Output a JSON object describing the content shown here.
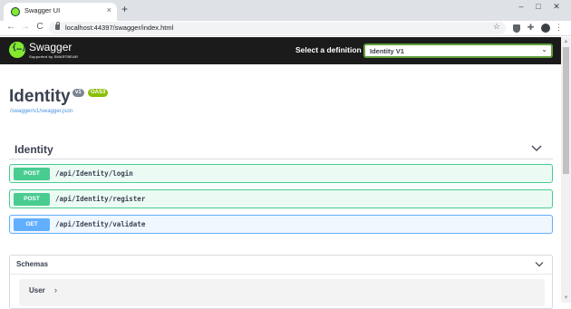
{
  "browser": {
    "tab_title": "Swagger UI",
    "tab_close": "×",
    "new_tab": "+",
    "url": "localhost:44397/swagger/index.html",
    "back": "←",
    "forward": "→",
    "reload": "C",
    "star": "☆",
    "win_minimize": "–",
    "win_maximize": "□",
    "win_close": "✕",
    "menu": "⋮",
    "extensions": "✚"
  },
  "topbar": {
    "logo_glyph": "{…}",
    "logo_text": "Swagger",
    "logo_sub": "Supported by SMARTBEAR",
    "definition_label": "Select a definition",
    "definition_value": "Identity V1",
    "definition_chevron": "⌄"
  },
  "info": {
    "title": "Identity",
    "version_badge": "v1",
    "oas_badge": "OAS3",
    "spec_link": "/swagger/v1/swagger.json"
  },
  "tag": {
    "name": "Identity",
    "operations": [
      {
        "method": "POST",
        "path": "/api/Identity/login"
      },
      {
        "method": "POST",
        "path": "/api/Identity/register"
      },
      {
        "method": "GET",
        "path": "/api/Identity/validate"
      }
    ]
  },
  "schemas": {
    "title": "Schemas",
    "models": [
      {
        "name": "User",
        "arrow": "›"
      }
    ]
  },
  "colors": {
    "post": "#49cc90",
    "get": "#61affe",
    "topbar": "#1b1b1b",
    "swagger_green": "#85ea2d",
    "oas_badge": "#89bf04",
    "link": "#4990e2"
  },
  "scrollbar": {
    "up": "▲",
    "down": "▼"
  }
}
